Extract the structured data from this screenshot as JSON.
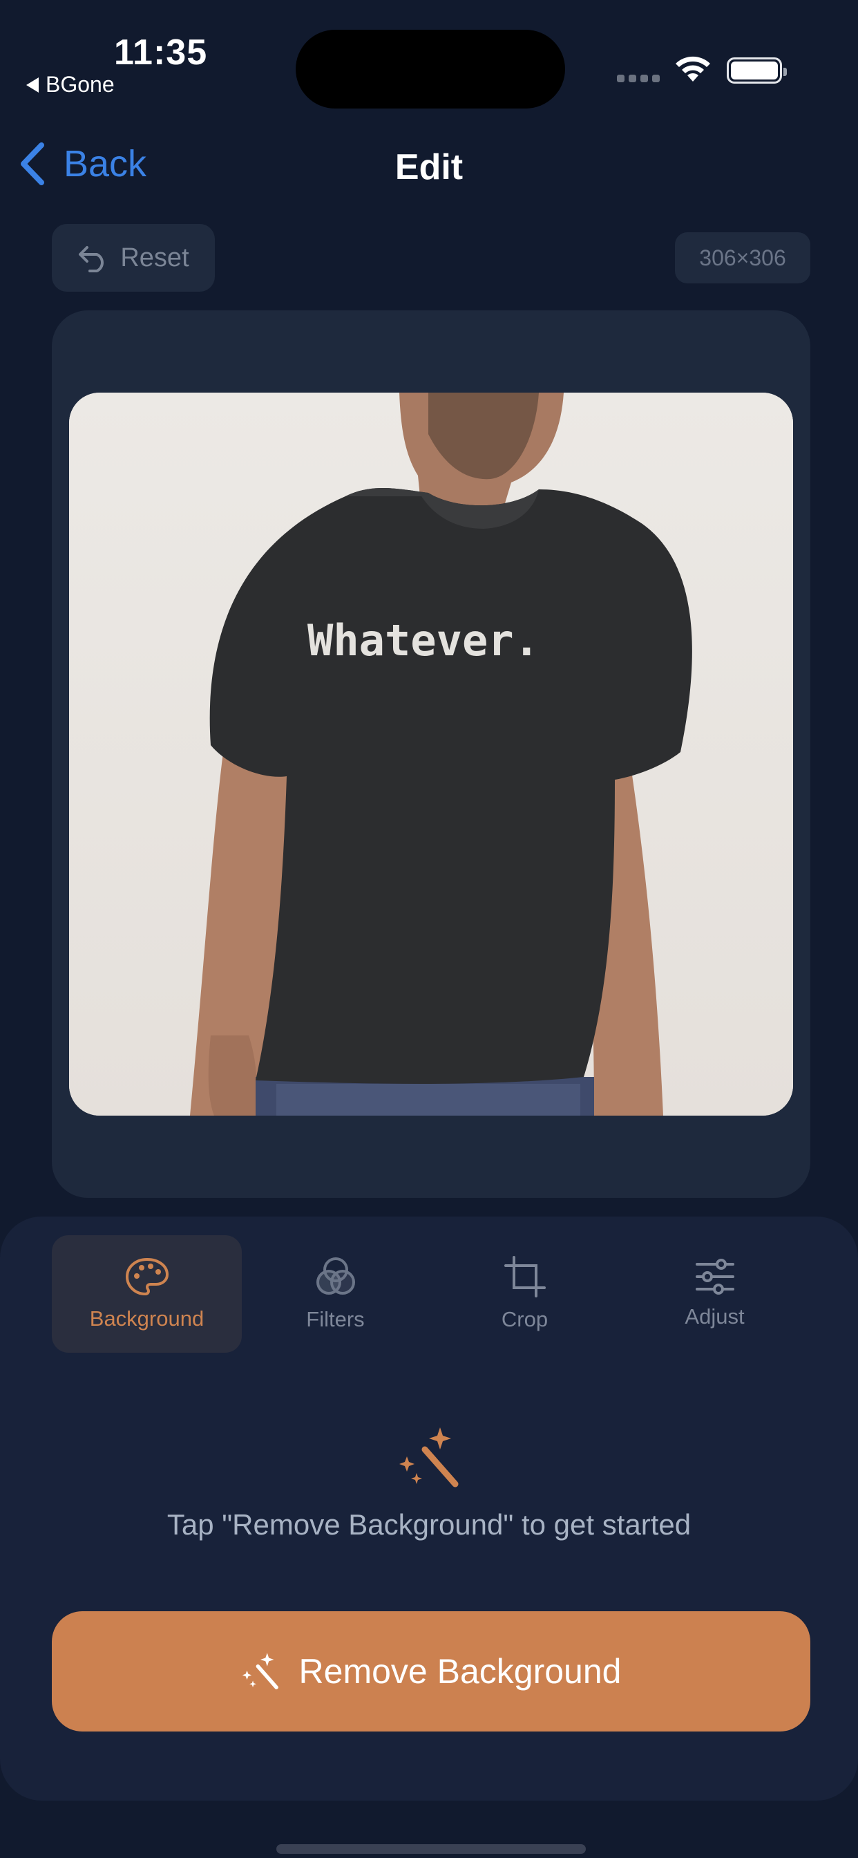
{
  "status_bar": {
    "time": "11:35",
    "back_app": "BGone"
  },
  "nav": {
    "back_label": "Back",
    "title": "Edit"
  },
  "toolbar": {
    "reset_label": "Reset",
    "image_size": "306×306"
  },
  "photo": {
    "shirt_text": "Whatever."
  },
  "tabs": [
    {
      "label": "Background",
      "icon": "palette-icon",
      "active": true
    },
    {
      "label": "Filters",
      "icon": "filters-icon",
      "active": false
    },
    {
      "label": "Crop",
      "icon": "crop-icon",
      "active": false
    },
    {
      "label": "Adjust",
      "icon": "sliders-icon",
      "active": false
    }
  ],
  "hint": {
    "text": "Tap \"Remove Background\" to get started",
    "icon": "magic-wand-icon"
  },
  "primary_action": {
    "label": "Remove Background",
    "icon": "magic-wand-icon"
  },
  "colors": {
    "background": "#111a2e",
    "card": "#1e293d",
    "accent": "#cc8150",
    "link": "#3b82e6"
  }
}
